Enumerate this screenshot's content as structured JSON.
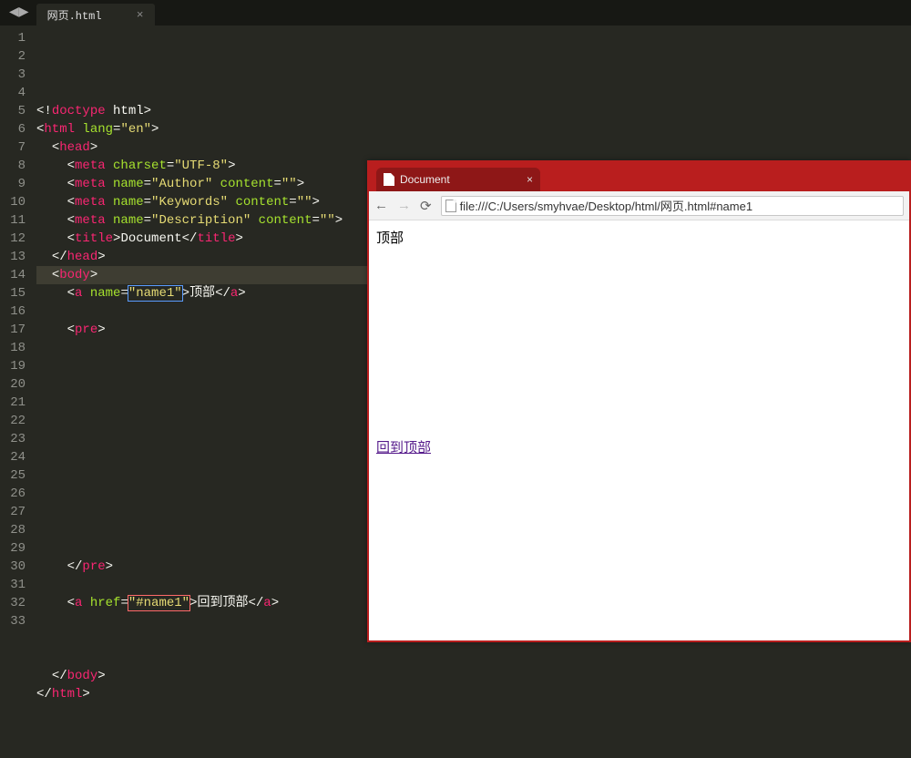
{
  "editor": {
    "tab_name": "网页.html",
    "max_line": 33,
    "code": {
      "l1": {
        "a": "<!",
        "b": "doctype",
        "c": " html",
        "d": ">"
      },
      "l2": {
        "a": "<",
        "b": "html",
        "att": "lang",
        "eq": "=",
        "val": "\"en\"",
        "d": ">"
      },
      "l3": {
        "a": "<",
        "b": "head",
        "d": ">"
      },
      "l4": {
        "a": "<",
        "b": "meta",
        "att": "charset",
        "eq": "=",
        "val": "\"UTF-8\"",
        "d": ">"
      },
      "l5": {
        "a": "<",
        "b": "meta",
        "att": "name",
        "eq": "=",
        "val": "\"Author\"",
        "att2": "content",
        "eq2": "=",
        "val2": "\"\"",
        "d": ">"
      },
      "l6": {
        "a": "<",
        "b": "meta",
        "att": "name",
        "eq": "=",
        "val": "\"Keywords\"",
        "att2": "content",
        "eq2": "=",
        "val2": "\"\"",
        "d": ">"
      },
      "l7": {
        "a": "<",
        "b": "meta",
        "att": "name",
        "eq": "=",
        "val": "\"Description\"",
        "att2": "content",
        "eq2": "=",
        "val2": "\"\"",
        "d": ">"
      },
      "l8": {
        "a": "<",
        "b": "title",
        "d": ">",
        "txt": "Document",
        "ca": "</",
        "cb": "title",
        "cd": ">"
      },
      "l9": {
        "a": "</",
        "b": "head",
        "d": ">"
      },
      "l10": {
        "a": "<",
        "b": "body",
        "d": ">"
      },
      "l11": {
        "a": "<",
        "b": "a",
        "att": "name",
        "eq": "=",
        "val": "\"name1\"",
        "d": ">",
        "txt": "顶部",
        "ca": "</",
        "cb": "a",
        "cd": ">"
      },
      "l13": {
        "a": "<",
        "b": "pre",
        "d": ">"
      },
      "l26": {
        "a": "</",
        "b": "pre",
        "d": ">"
      },
      "l28": {
        "a": "<",
        "b": "a",
        "att": "href",
        "eq": "=",
        "val": "\"#name1\"",
        "d": ">",
        "txt": "回到顶部",
        "ca": "</",
        "cb": "a",
        "cd": ">"
      },
      "l32": {
        "a": "</",
        "b": "body",
        "d": ">"
      },
      "l33": {
        "a": "</",
        "b": "html",
        "d": ">"
      }
    }
  },
  "browser": {
    "tab_title": "Document",
    "url": "file:///C:/Users/smyhvae/Desktop/html/网页.html#name1",
    "page_text": "顶部",
    "link_text": "回到顶部"
  }
}
